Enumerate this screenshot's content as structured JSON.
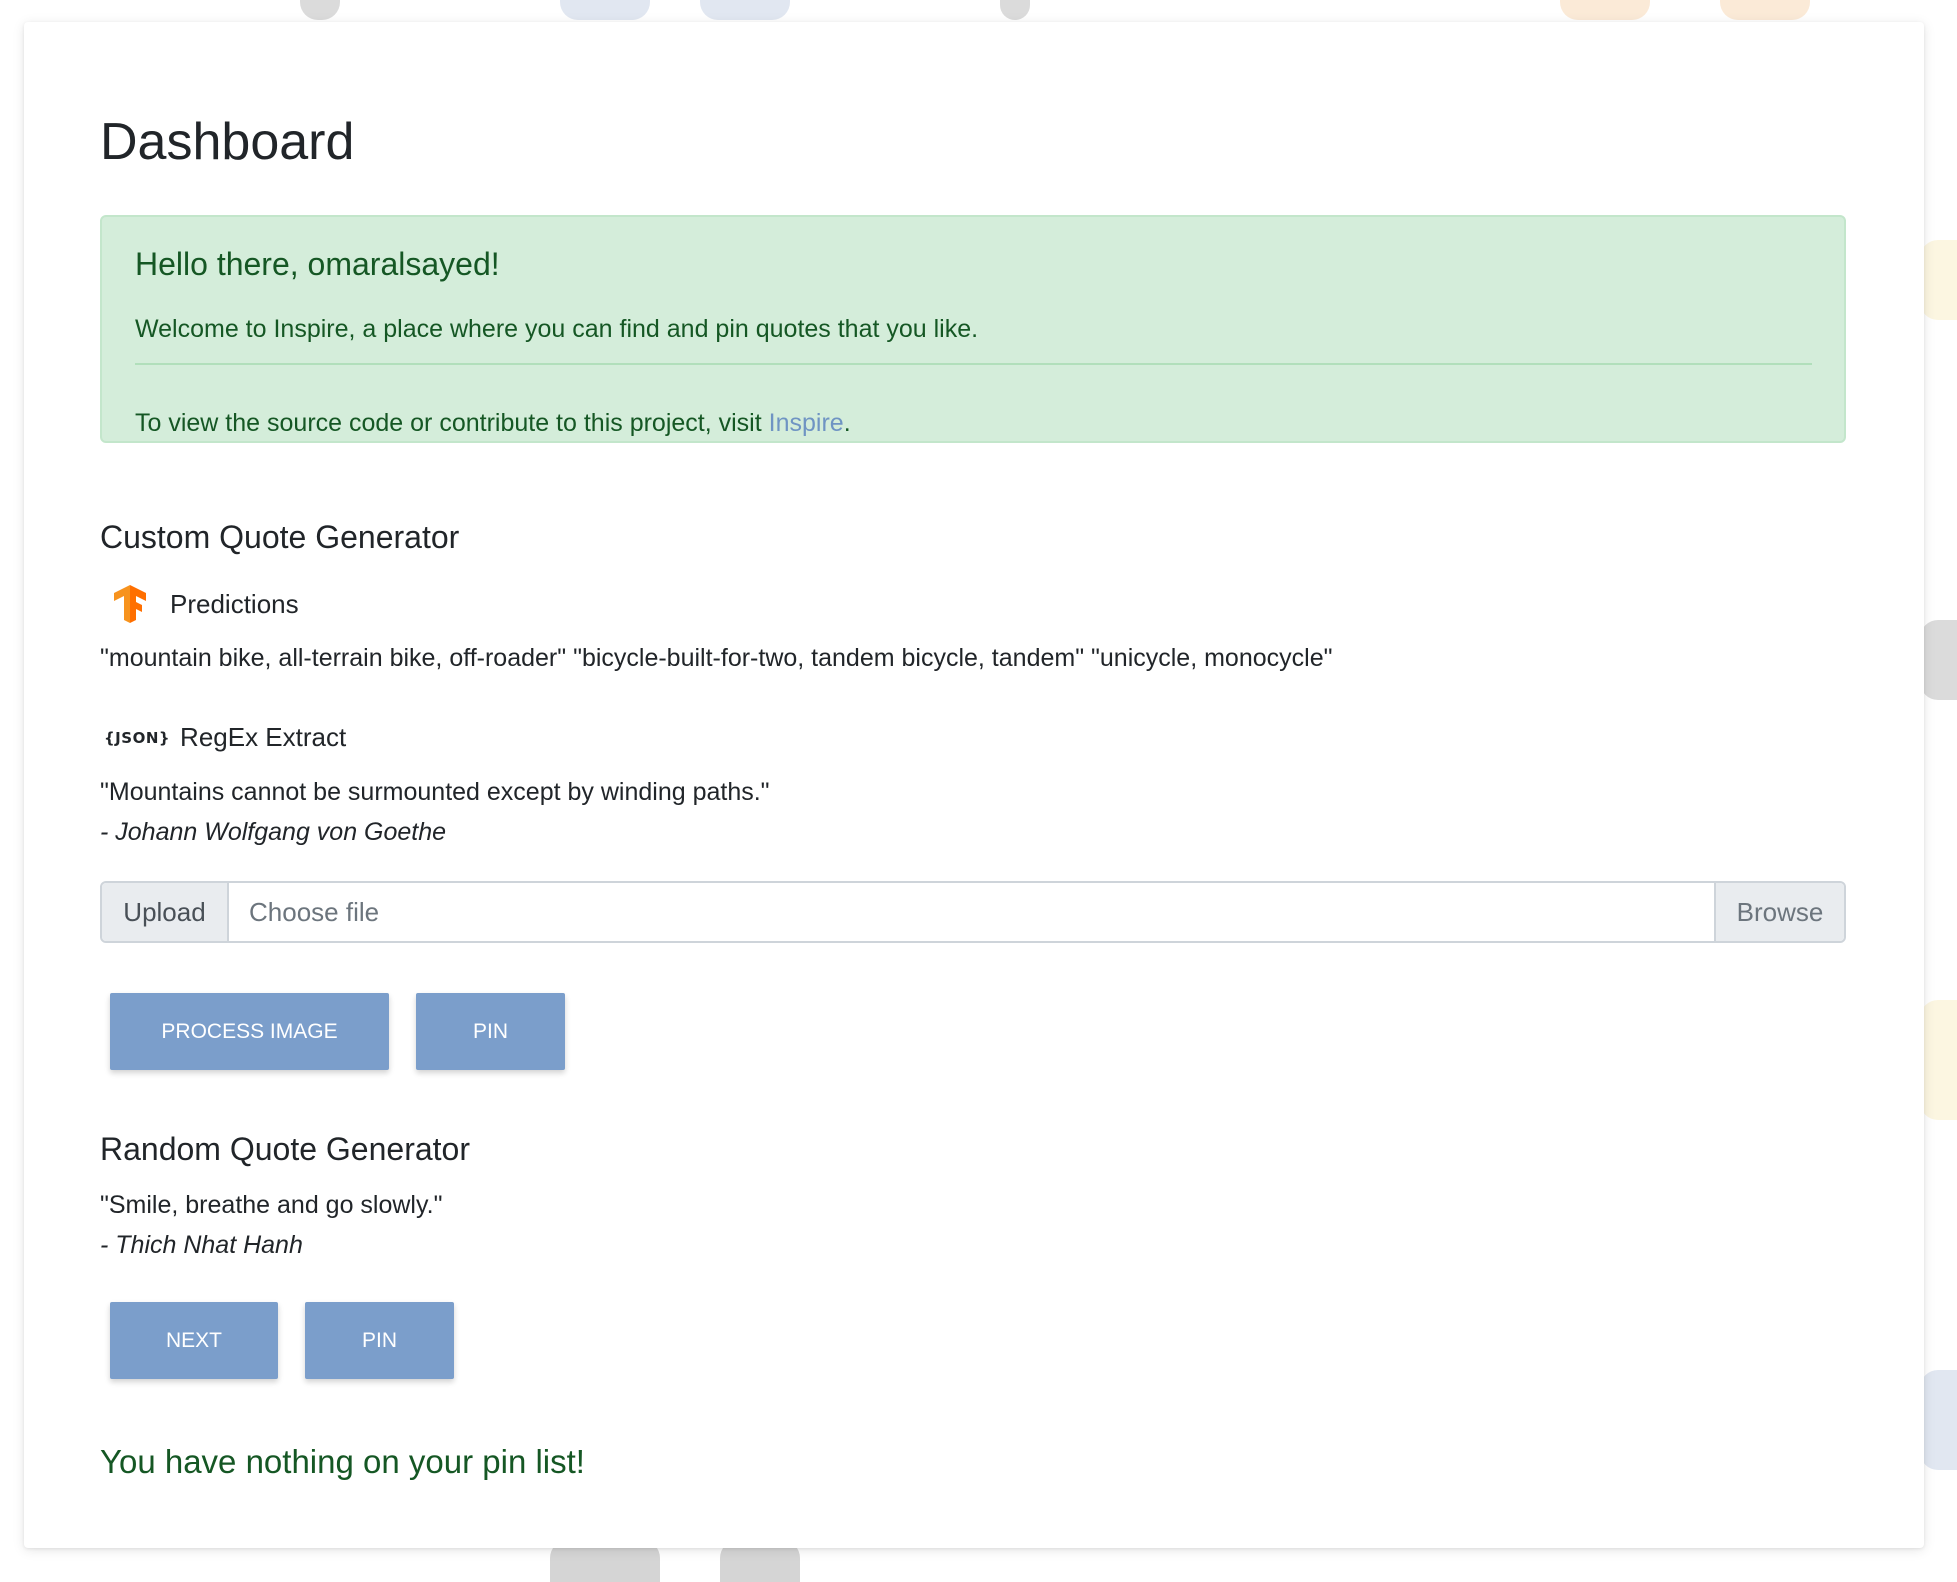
{
  "page": {
    "title": "Dashboard"
  },
  "alert": {
    "heading": "Hello there, omaralsayed!",
    "welcome": "Welcome to Inspire, a place where you can find and pin quotes that you like.",
    "source_prefix": "To view the source code or contribute to this project, visit ",
    "source_link": "Inspire",
    "source_suffix": "."
  },
  "custom": {
    "title": "Custom Quote Generator",
    "predictions_label": "Predictions",
    "predictions_text": "\"mountain bike, all-terrain bike, off-roader\" \"bicycle-built-for-two, tandem bicycle, tandem\" \"unicycle, monocycle\"",
    "json_icon_text": "{JSON}",
    "regex_label": "RegEx Extract",
    "quote": "\"Mountains cannot be surmounted except by winding paths.\"",
    "author": "- Johann Wolfgang von Goethe",
    "upload_label": "Upload",
    "file_placeholder": "Choose file",
    "browse_label": "Browse",
    "process_button": "PROCESS IMAGE",
    "pin_button": "PIN"
  },
  "random": {
    "title": "Random Quote Generator",
    "quote": "\"Smile, breathe and go slowly.\"",
    "author": "- Thich Nhat Hanh",
    "next_button": "NEXT",
    "pin_button": "PIN"
  },
  "pins": {
    "empty_message": "You have nothing on your pin list!"
  },
  "colors": {
    "accent_button": "#7b9ecb",
    "alert_bg": "#d4edda",
    "alert_text": "#155724",
    "link": "#6f94c3",
    "tf_orange": "#f7931e"
  }
}
